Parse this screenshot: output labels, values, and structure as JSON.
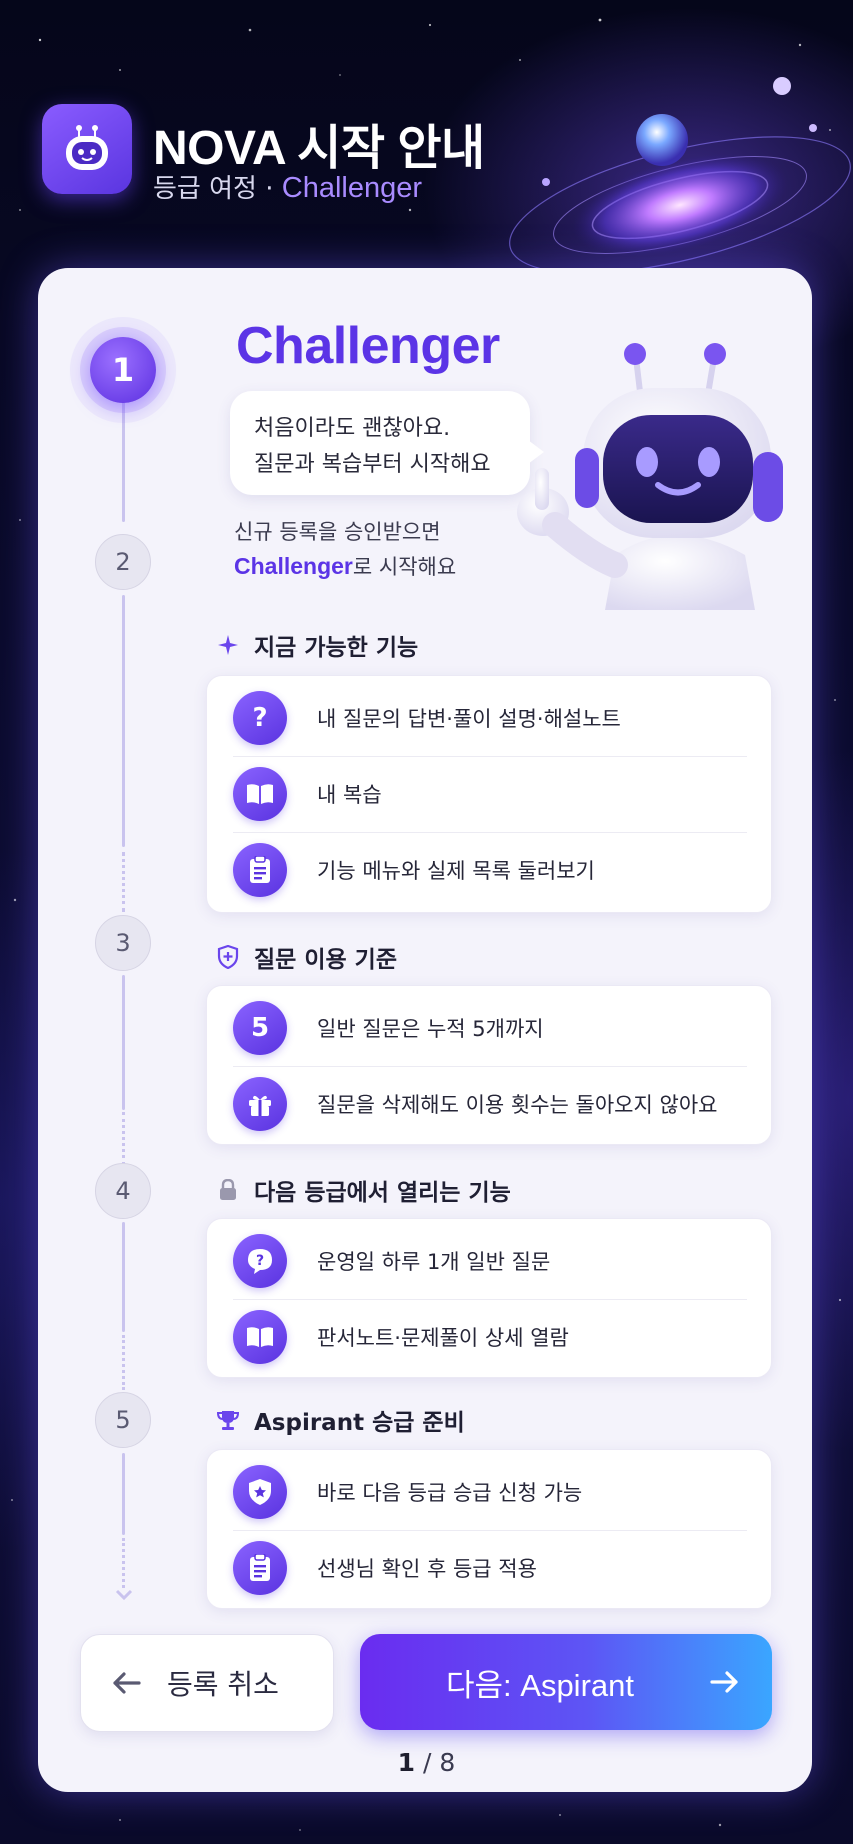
{
  "header": {
    "title": "NOVA 시작 안내",
    "subtitle_prefix": "등급 여정 ·",
    "subtitle_grade": "Challenger"
  },
  "steps": [
    "1",
    "2",
    "3",
    "4",
    "5"
  ],
  "intro": {
    "grade": "Challenger",
    "bubble_line1": "처음이라도 괜찮아요.",
    "bubble_line2": "질문과 복습부터 시작해요",
    "note_line1": "신규 등록을 승인받으면",
    "note_highlight": "Challenger",
    "note_suffix": "로 시작해요"
  },
  "sections": [
    {
      "title": "지금 가능한 기능",
      "icon": "sparkle-icon",
      "items": [
        {
          "icon": "question-icon",
          "text": "내 질문의 답변·풀이 설명·해설노트"
        },
        {
          "icon": "book-icon",
          "text": "내 복습"
        },
        {
          "icon": "clipboard-icon",
          "text": "기능 메뉴와 실제 목록 둘러보기"
        }
      ]
    },
    {
      "title": "질문 이용 기준",
      "icon": "shield-plus-icon",
      "items": [
        {
          "icon": "number-five-icon",
          "badge": "5",
          "text": "일반 질문은 누적 5개까지"
        },
        {
          "icon": "gift-icon",
          "text": "질문을 삭제해도 이용 횟수는 돌아오지 않아요"
        }
      ]
    },
    {
      "title": "다음 등급에서 열리는 기능",
      "icon": "lock-icon",
      "items": [
        {
          "icon": "question-bubble-icon",
          "text": "운영일 하루 1개 일반 질문"
        },
        {
          "icon": "book-icon",
          "text": "판서노트·문제풀이 상세 열람"
        }
      ]
    },
    {
      "title": "Aspirant 승급 준비",
      "icon": "trophy-icon",
      "items": [
        {
          "icon": "shield-star-icon",
          "text": "바로 다음 등급 승급 신청 가능"
        },
        {
          "icon": "clipboard-icon",
          "text": "선생님 확인 후 등급 적용"
        }
      ]
    }
  ],
  "actions": {
    "cancel_label": "등록 취소",
    "next_label": "다음: Aspirant"
  },
  "pager": {
    "current": "1",
    "total": "/ 8"
  },
  "colors": {
    "accent": "#5b34e6",
    "card": "#f4f3fb",
    "next_gradient_end": "#3aa6ff"
  }
}
